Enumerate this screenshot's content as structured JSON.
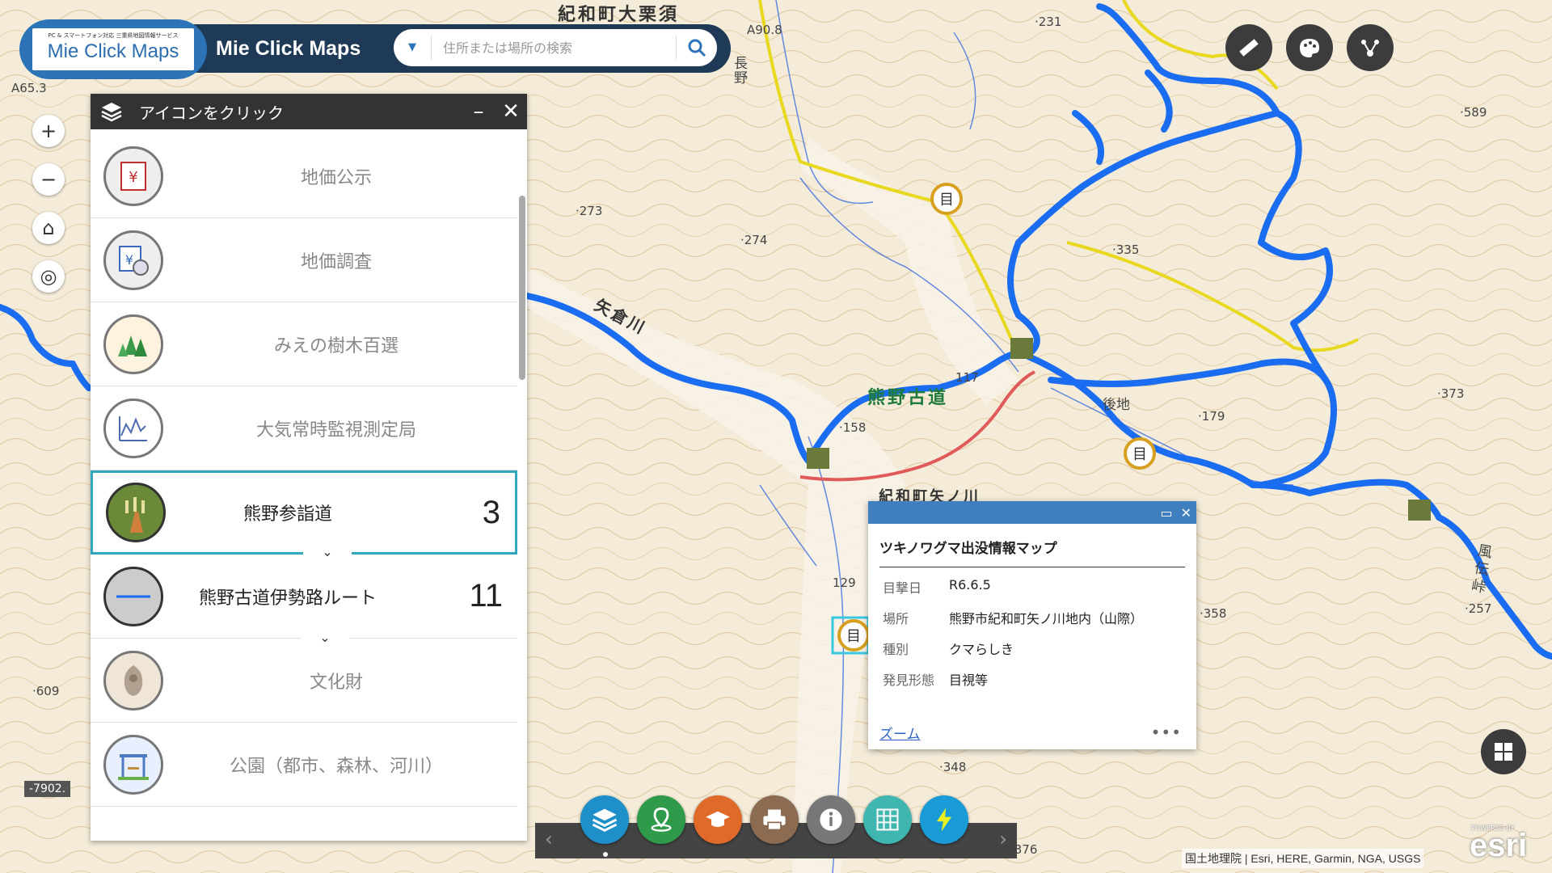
{
  "header": {
    "logo_small": "PC & スマートフォン対応 三重県地図情報サービス",
    "logo_text": "Mie Click Maps",
    "app_title": "Mie Click Maps",
    "search_placeholder": "住所または場所の検索"
  },
  "map_tools": [
    {
      "name": "zoom-in-button",
      "glyph": "+"
    },
    {
      "name": "zoom-out-button",
      "glyph": "−"
    },
    {
      "name": "home-button",
      "glyph": "⌂"
    },
    {
      "name": "locate-button",
      "glyph": "◎"
    }
  ],
  "panel": {
    "title": "アイコンをクリック",
    "items": [
      {
        "label": "地価公示",
        "count": "",
        "icon": "yen-document-icon"
      },
      {
        "label": "地価調査",
        "count": "",
        "icon": "yen-magnifier-icon"
      },
      {
        "label": "みえの樹木百選",
        "count": "",
        "icon": "trees-icon"
      },
      {
        "label": "大気常時監視測定局",
        "count": "",
        "icon": "line-graph-icon"
      },
      {
        "label": "熊野参詣道",
        "count": "3",
        "icon": "pilgrimage-road-icon"
      },
      {
        "label": "熊野古道伊勢路ルート",
        "count": "11",
        "icon": "route-line-icon"
      },
      {
        "label": "文化財",
        "count": "",
        "icon": "cultural-property-icon"
      },
      {
        "label": "公園（都市、森林、河川）",
        "count": "",
        "icon": "park-icon"
      }
    ]
  },
  "map_labels": {
    "town_top": "紀和町大栗須",
    "river": "矢倉川",
    "kumano": "熊野古道",
    "town_mid": "紀和町矢ノ川",
    "gochi": "後地",
    "naga": "長野",
    "kaze": "風伝峠",
    "e231": "·231",
    "e589": "·589",
    "e273": "·273",
    "e274": "·274",
    "e335": "·335",
    "e117": "117",
    "e158": "·158",
    "e179": "·179",
    "e373": "·373",
    "e129": "129",
    "e358": "·358",
    "e257": "·257",
    "e609": "·609",
    "e348": "·348",
    "e376": "·376",
    "e90": "A90.8",
    "e65": "A65.3"
  },
  "popup": {
    "title": "ツキノワグマ出没情報マップ",
    "rows": [
      {
        "key": "目撃日",
        "value": "R6.6.5"
      },
      {
        "key": "場所",
        "value": "熊野市紀和町矢ノ川地内（山際）"
      },
      {
        "key": "種別",
        "value": "クマらしき"
      },
      {
        "key": "発見形態",
        "value": "目視等"
      }
    ],
    "zoom_label": "ズーム",
    "more_label": "•••"
  },
  "scale_text": "-7902.",
  "attribution": "国土地理院 | Esri, HERE, Garmin, NGA, USGS",
  "esri_powered": "POWERED BY",
  "esri_logo": "esri",
  "colors": {
    "route_blue": "#1a6df0",
    "panel_header": "#333333",
    "active_border": "#31a8bd",
    "popup_bar": "#3f7fbf"
  },
  "toolbar": [
    {
      "name": "layers-button",
      "color": "#1e8fc9"
    },
    {
      "name": "places-button",
      "color": "#2e9a4a"
    },
    {
      "name": "learning-button",
      "color": "#e06a2a"
    },
    {
      "name": "print-button",
      "color": "#8b6b52"
    },
    {
      "name": "info-button",
      "color": "#777777"
    },
    {
      "name": "grid-select-button",
      "color": "#3fb6b0"
    },
    {
      "name": "quick-button",
      "color": "#1a9ad6"
    }
  ]
}
